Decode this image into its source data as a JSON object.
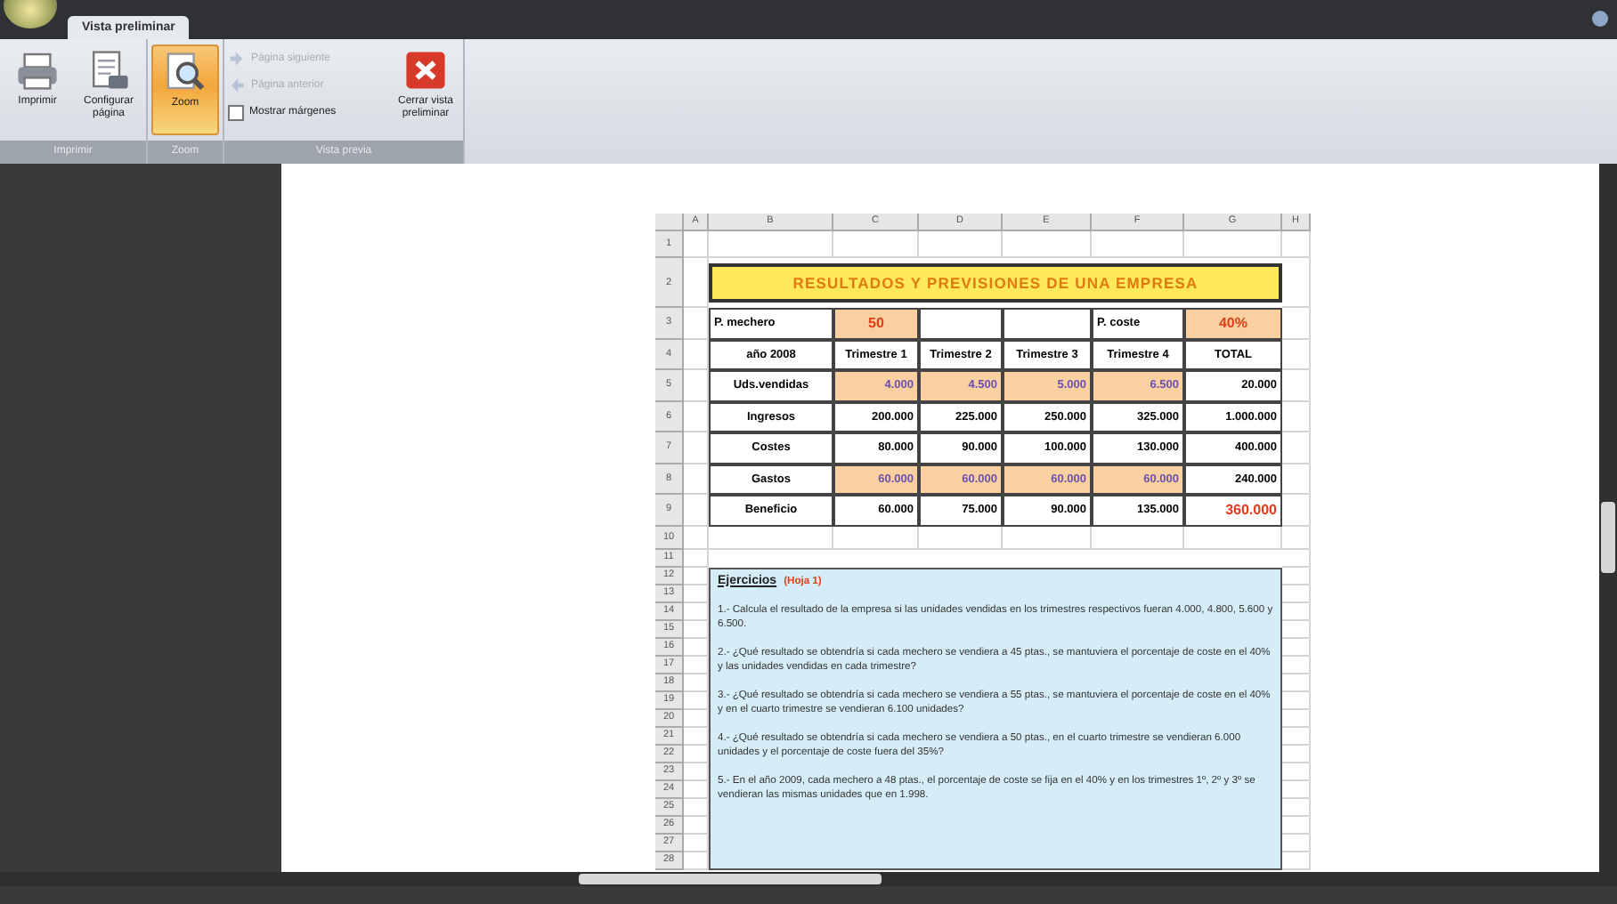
{
  "tabs": [
    {
      "label": "Vista preliminar",
      "selected": true
    }
  ],
  "groups": [
    {
      "label": "Imprimir",
      "items": [
        {
          "kind": "large",
          "label": "Imprimir",
          "selected": false
        },
        {
          "kind": "large",
          "label": "Configurar página",
          "selected": false
        }
      ]
    },
    {
      "label": "Zoom",
      "items": [
        {
          "kind": "large",
          "label": "Zoom",
          "selected": true
        }
      ]
    },
    {
      "label": "Vista previa",
      "items": [
        {
          "kind": "small",
          "label": "Página siguiente",
          "disabled": true
        },
        {
          "kind": "small",
          "label": "Página anterior",
          "disabled": true
        },
        {
          "kind": "check",
          "label": "Mostrar márgenes",
          "checked": false
        },
        {
          "kind": "large",
          "label": "Cerrar vista preliminar",
          "selected": false
        }
      ]
    }
  ],
  "sheet": {
    "columns": [
      "A",
      "B",
      "C",
      "D",
      "E",
      "F",
      "G",
      "H"
    ],
    "row_numbers": [
      "1",
      "2",
      "3",
      "4",
      "5",
      "6",
      "7",
      "8",
      "9",
      "10",
      "11",
      "12",
      "13",
      "14",
      "15",
      "16",
      "17",
      "18",
      "19",
      "20",
      "21",
      "22",
      "23",
      "24",
      "25",
      "26",
      "27",
      "28"
    ],
    "title": "RESULTADOS Y PREVISIONES DE UNA EMPRESA",
    "rows": [
      [
        {
          "kind": "empty"
        },
        {
          "kind": "label",
          "text": "P. mechero"
        },
        {
          "kind": "param",
          "text": "50"
        },
        {
          "kind": "blank"
        },
        {
          "kind": "blank"
        },
        {
          "kind": "label",
          "text": "P. coste"
        },
        {
          "kind": "param",
          "text": "40%"
        }
      ],
      [
        {
          "kind": "empty"
        },
        {
          "kind": "header",
          "text": "año 2008"
        },
        {
          "kind": "header",
          "text": "Trimestre 1"
        },
        {
          "kind": "header",
          "text": "Trimestre 2"
        },
        {
          "kind": "header",
          "text": "Trimestre 3"
        },
        {
          "kind": "header",
          "text": "Trimestre 4"
        },
        {
          "kind": "header",
          "text": "TOTAL"
        }
      ],
      [
        {
          "kind": "empty"
        },
        {
          "kind": "header",
          "text": "Uds.vendidas"
        },
        {
          "kind": "input",
          "text": "4.000"
        },
        {
          "kind": "input",
          "text": "4.500"
        },
        {
          "kind": "input",
          "text": "5.000"
        },
        {
          "kind": "input",
          "text": "6.500"
        },
        {
          "kind": "value",
          "text": "20.000"
        }
      ],
      [
        {
          "kind": "empty"
        },
        {
          "kind": "header",
          "text": "Ingresos"
        },
        {
          "kind": "value",
          "text": "200.000"
        },
        {
          "kind": "value",
          "text": "225.000"
        },
        {
          "kind": "value",
          "text": "250.000"
        },
        {
          "kind": "value",
          "text": "325.000"
        },
        {
          "kind": "value",
          "text": "1.000.000"
        }
      ],
      [
        {
          "kind": "empty"
        },
        {
          "kind": "header",
          "text": "Costes"
        },
        {
          "kind": "value",
          "text": "80.000"
        },
        {
          "kind": "value",
          "text": "90.000"
        },
        {
          "kind": "value",
          "text": "100.000"
        },
        {
          "kind": "value",
          "text": "130.000"
        },
        {
          "kind": "value",
          "text": "400.000"
        }
      ],
      [
        {
          "kind": "empty"
        },
        {
          "kind": "header",
          "text": "Gastos"
        },
        {
          "kind": "input",
          "text": "60.000"
        },
        {
          "kind": "input",
          "text": "60.000"
        },
        {
          "kind": "input",
          "text": "60.000"
        },
        {
          "kind": "input",
          "text": "60.000"
        },
        {
          "kind": "value",
          "text": "240.000"
        }
      ],
      [
        {
          "kind": "empty"
        },
        {
          "kind": "header",
          "text": "Beneficio"
        },
        {
          "kind": "value",
          "text": "60.000"
        },
        {
          "kind": "value",
          "text": "75.000"
        },
        {
          "kind": "value",
          "text": "90.000"
        },
        {
          "kind": "value",
          "text": "135.000"
        },
        {
          "kind": "result",
          "text": "360.000"
        }
      ]
    ],
    "exercises": {
      "heading": "Ejercicios",
      "note": "(Hoja 1)",
      "items": [
        "1.- Calcula el resultado de la empresa si las unidades vendidas en los trimestres respectivos fueran 4.000, 4.800, 5.600 y 6.500.",
        "2.- ¿Qué resultado se obtendría si cada mechero se vendiera a 45 ptas., se mantuviera el porcentaje de coste en el 40% y las unidades vendidas en cada trimestre?",
        "3.- ¿Qué resultado se obtendría si cada mechero se vendiera a 55 ptas., se mantuviera el porcentaje de coste en el 40% y en el cuarto trimestre se vendieran 6.100 unidades?",
        "4.- ¿Qué resultado se obtendría si cada mechero se vendiera a 50 ptas., en el cuarto trimestre se vendieran 6.000 unidades y el porcentaje de coste fuera del 35%?",
        "5.- En el año 2009, cada mechero a 48 ptas., el porcentaje de coste se fija en el 40% y en los trimestres 1º, 2º y 3º se vendieran las mismas unidades que en 1.998."
      ]
    }
  }
}
